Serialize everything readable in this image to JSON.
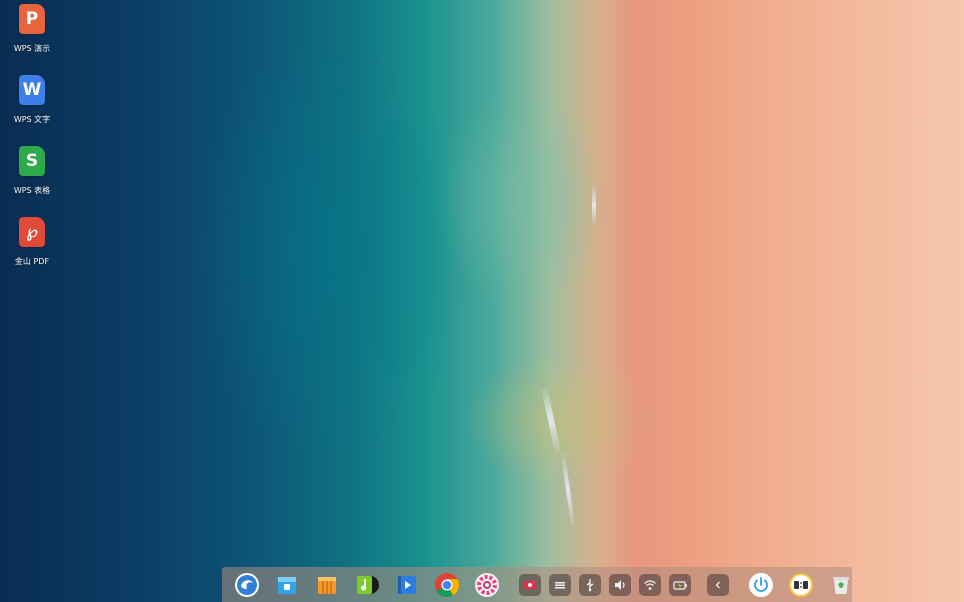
{
  "desktop": {
    "icons": [
      {
        "name": "wps-presentation-icon",
        "label": "WPS 演示",
        "glyph": "P",
        "color": "#e8643c"
      },
      {
        "name": "wps-writer-icon",
        "label": "WPS 文字",
        "glyph": "W",
        "color": "#3d7ee8"
      },
      {
        "name": "wps-spreadsheet-icon",
        "label": "WPS 表格",
        "glyph": "S",
        "color": "#2eaa4a"
      },
      {
        "name": "kingsoft-pdf-icon",
        "label": "金山 PDF",
        "glyph": "℘",
        "color": "#e14a3b"
      }
    ]
  },
  "dock": {
    "apps": [
      "launcher-icon",
      "app-store-icon",
      "file-manager-icon",
      "music-player-icon",
      "video-player-icon",
      "chrome-browser-icon",
      "settings-icon"
    ],
    "tray": [
      "screen-recorder-icon",
      "keyboard-icon",
      "usb-icon",
      "volume-icon",
      "wifi-icon",
      "battery-icon",
      "collapse-tray-icon"
    ],
    "right": [
      "power-icon",
      "clock-icon",
      "trash-icon"
    ]
  }
}
